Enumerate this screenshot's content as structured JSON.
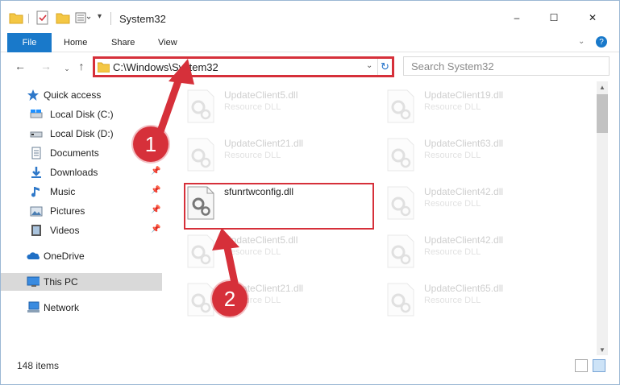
{
  "window": {
    "title": "System32",
    "controls": {
      "minimize": "–",
      "maximize": "☐",
      "close": "✕"
    }
  },
  "ribbon": {
    "file": "File",
    "home": "Home",
    "share": "Share",
    "view": "View"
  },
  "nav": {
    "address": "C:\\Windows\\System32",
    "search_placeholder": "Search System32"
  },
  "sidebar": {
    "items": [
      {
        "label": "Quick access",
        "icon": "star-icon"
      },
      {
        "label": "Local Disk (C:)",
        "icon": "drive-icon"
      },
      {
        "label": "Local Disk (D:)",
        "icon": "drive-icon"
      },
      {
        "label": "Documents",
        "icon": "documents-icon"
      },
      {
        "label": "Downloads",
        "icon": "download-icon"
      },
      {
        "label": "Music",
        "icon": "music-icon"
      },
      {
        "label": "Pictures",
        "icon": "pictures-icon"
      },
      {
        "label": "Videos",
        "icon": "videos-icon"
      },
      {
        "label": "OneDrive",
        "icon": "cloud-icon"
      },
      {
        "label": "This PC",
        "icon": "computer-icon"
      },
      {
        "label": "Network",
        "icon": "network-icon"
      }
    ]
  },
  "files": [
    {
      "name": "UpdateClient5.dll",
      "type": "Resource DLL"
    },
    {
      "name": "UpdateClient19.dll",
      "type": "Resource DLL"
    },
    {
      "name": "UpdateClient21.dll",
      "type": "Resource DLL"
    },
    {
      "name": "UpdateClient63.dll",
      "type": "Resource DLL"
    },
    {
      "name": "sfunrtwconfig.dll",
      "type": ""
    },
    {
      "name": "UpdateClient42.dll",
      "type": "Resource DLL"
    },
    {
      "name": "UpdateClient5.dll",
      "type": "Resource DLL"
    },
    {
      "name": "UpdateClient42.dll",
      "type": "Resource DLL"
    },
    {
      "name": "UpdateClient21.dll",
      "type": "Resource DLL"
    },
    {
      "name": "UpdateClient65.dll",
      "type": "Resource DLL"
    }
  ],
  "status": {
    "count": "148 items"
  },
  "annotations": {
    "step1": "1",
    "step2": "2"
  },
  "colors": {
    "accent": "#1979ca",
    "highlight": "#d6303a"
  }
}
